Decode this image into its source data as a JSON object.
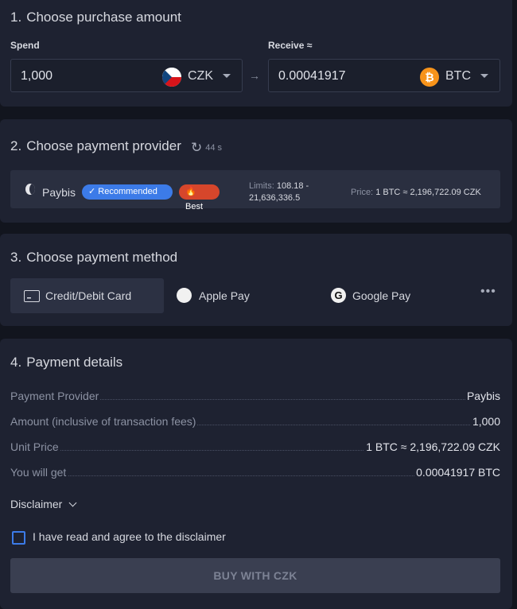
{
  "step1": {
    "number": "1.",
    "title": "Choose purchase amount",
    "spend_label": "Spend",
    "spend_value": "1,000",
    "spend_currency": "CZK",
    "receive_label": "Receive ≈",
    "receive_value": "0.00041917",
    "receive_currency": "BTC",
    "arrow": "→"
  },
  "step2": {
    "number": "2.",
    "title": "Choose payment provider",
    "timer": "44 s",
    "provider": {
      "name": "Paybis",
      "recommended_badge": "Recommended",
      "best_badge": "Best",
      "limits_label": "Limits:",
      "limits_min": "108.18 -",
      "limits_max": "21,636,336.5",
      "price_label": "Price:",
      "price_value": "1 BTC ≈ 2,196,722.09 CZK"
    }
  },
  "step3": {
    "number": "3.",
    "title": "Choose payment method",
    "methods": [
      {
        "label": "Credit/Debit Card",
        "icon": "credit-card-icon",
        "selected": true
      },
      {
        "label": "Apple Pay",
        "icon": "apple-icon",
        "selected": false
      },
      {
        "label": "Google Pay",
        "icon": "google-icon",
        "selected": false
      }
    ],
    "more": "•••"
  },
  "step4": {
    "number": "4.",
    "title": "Payment details",
    "rows": [
      {
        "label": "Payment Provider",
        "value": "Paybis"
      },
      {
        "label": "Amount (inclusive of transaction fees)",
        "value": "1,000"
      },
      {
        "label": "Unit Price",
        "value": "1 BTC ≈ 2,196,722.09 CZK"
      },
      {
        "label": "You will get",
        "value": "0.00041917 BTC"
      }
    ],
    "disclaimer": "Disclaimer",
    "agree_text": "I have read and agree to the disclaimer",
    "buy_button": "BUY WITH CZK"
  },
  "colors": {
    "background": "#12151e",
    "card": "#1e2231",
    "accent_blue": "#3c7be8",
    "best_red": "#d6462b",
    "btc_orange": "#f7931a"
  }
}
